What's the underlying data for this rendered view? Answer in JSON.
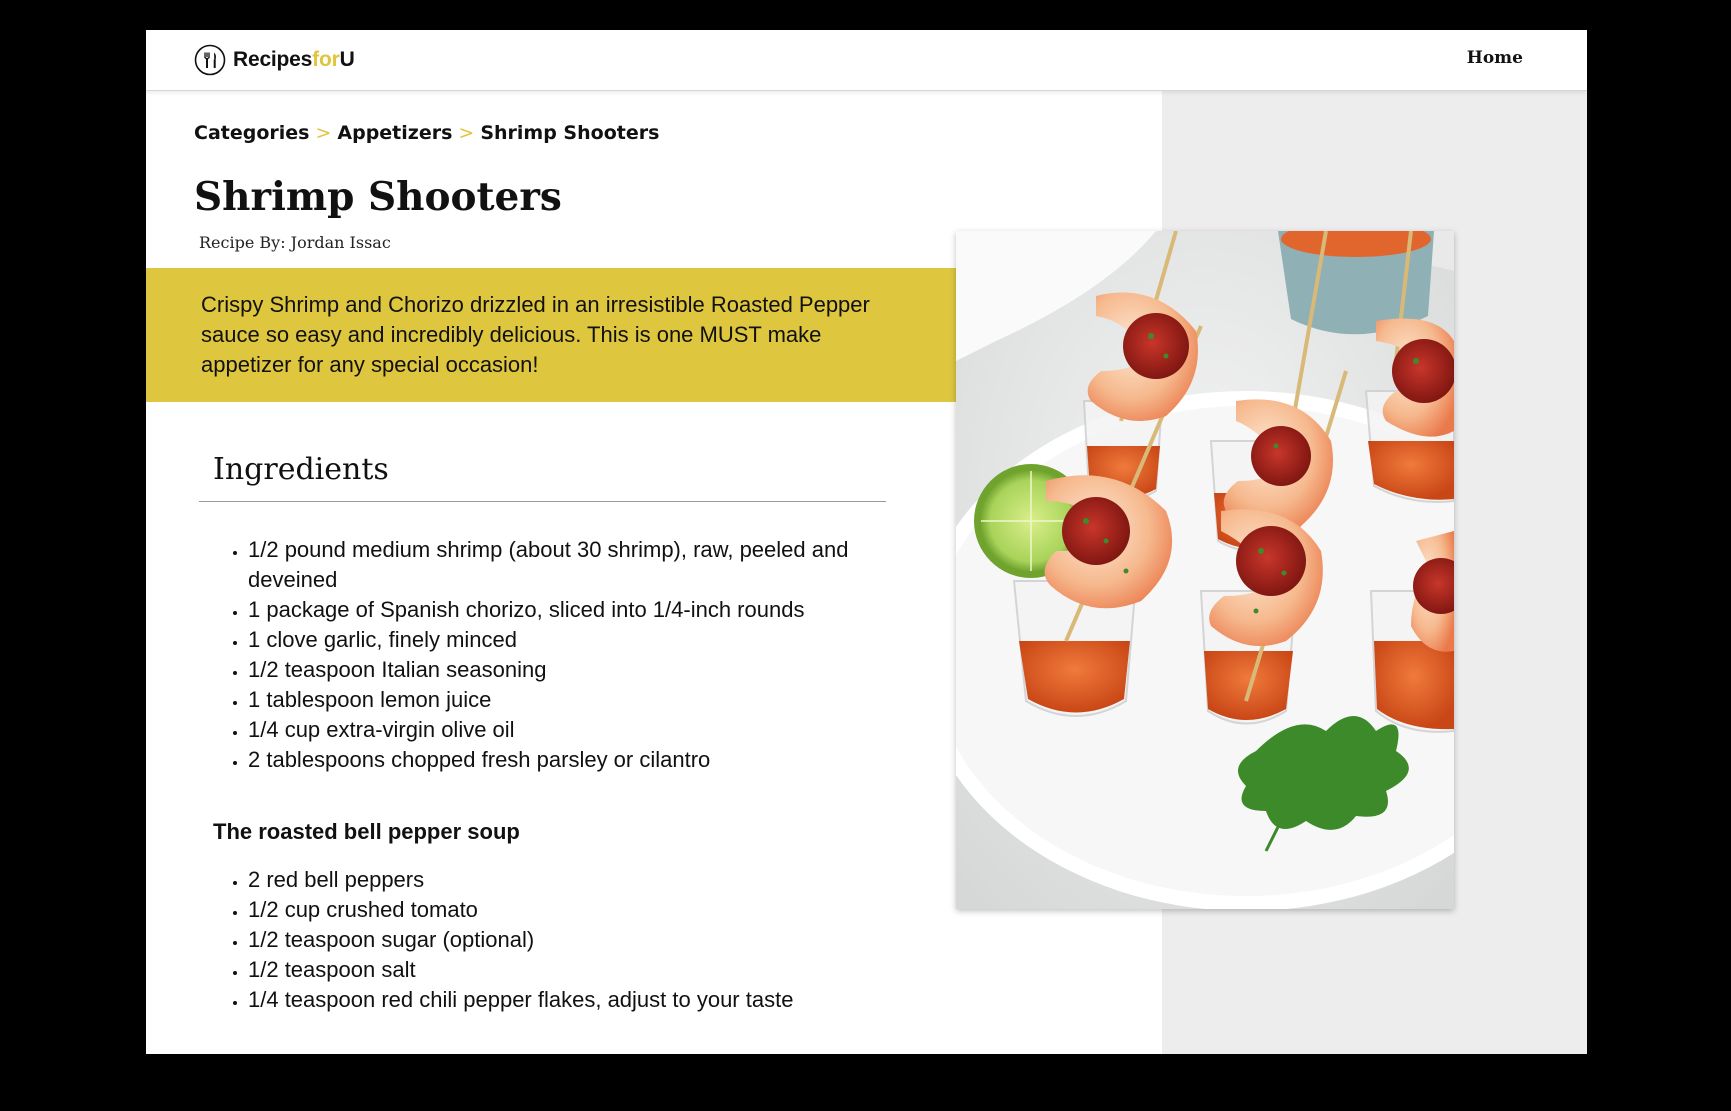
{
  "navbar": {
    "logo": {
      "part1": "Recipes",
      "part2": "for",
      "part3": "U"
    },
    "home_label": "Home"
  },
  "breadcrumb": {
    "items": [
      "Categories",
      "Appetizers",
      "Shrimp Shooters"
    ],
    "separator": ">"
  },
  "recipe": {
    "title": "Shrimp Shooters",
    "author": "Recipe By: Jordan Issac",
    "description": "Crispy Shrimp and Chorizo drizzled in an irresistible Roasted Pepper sauce so easy and incredibly delicious. This is one MUST make appetizer for any special occasion!",
    "image_icon": "shrimp-shooters-photo"
  },
  "ingredients": {
    "title": "Ingredients",
    "main": [
      " 1/2 pound medium shrimp (about 30 shrimp), raw, peeled and deveined",
      "1 package of Spanish chorizo, sliced into 1/4-inch rounds",
      "1 clove garlic, finely minced",
      "1/2 teaspoon Italian seasoning",
      "1 tablespoon lemon juice",
      "1/4 cup extra-virgin olive oil",
      "2 tablespoons chopped fresh parsley or cilantro"
    ],
    "soup_heading": "The roasted bell pepper soup",
    "soup": [
      "2 red bell peppers",
      "1/2 cup crushed tomato",
      "1/2 teaspoon sugar (optional)",
      "1/2 teaspoon salt",
      "1/4 teaspoon red chili pepper flakes, adjust to your taste"
    ]
  },
  "colors": {
    "accent": "#dec63f",
    "logo_accent": "#e1c43c",
    "panel": "#eeedee",
    "text": "#111111"
  }
}
